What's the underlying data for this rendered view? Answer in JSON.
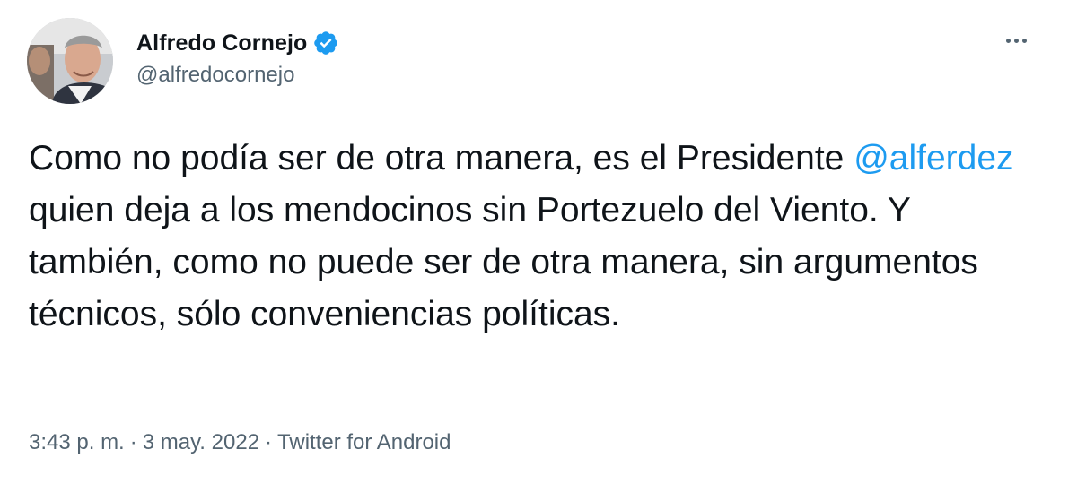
{
  "author": {
    "display_name": "Alfredo Cornejo",
    "handle": "@alfredocornejo",
    "verified_icon": "verified-badge-icon",
    "avatar_icon": "profile-photo"
  },
  "tweet": {
    "text_part1": "Como no podía ser de otra manera, es el Presidente ",
    "mention": "@alferdez",
    "text_part2": " quien deja a los mendocinos sin Portezuelo del Viento. Y también, como no puede ser de otra manera, sin argumentos técnicos, sólo conveniencias políticas."
  },
  "meta": {
    "time": "3:43 p. m.",
    "separator": "·",
    "date": "3 may. 2022",
    "source": "Twitter for Android"
  },
  "colors": {
    "accent": "#1d9bf0",
    "text": "#0f1419",
    "secondary": "#536471"
  },
  "more_icon": "more-options-icon"
}
